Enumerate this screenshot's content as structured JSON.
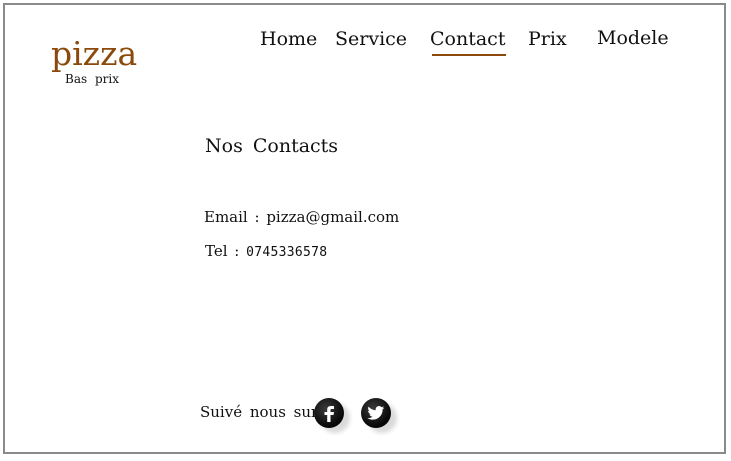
{
  "brand": {
    "name": "pizza",
    "tagline": "Bas prix",
    "color": "#8b4a0b"
  },
  "nav": {
    "items": [
      {
        "label": "Home"
      },
      {
        "label": "Service"
      },
      {
        "label": "Contact",
        "active": true
      },
      {
        "label": "Prix"
      },
      {
        "label": "Modele"
      }
    ]
  },
  "main": {
    "heading": "Nos Contacts",
    "email_label": "Email :",
    "email_value": "pizza@gmail.com",
    "tel_label": "Tel :",
    "tel_value": "0745336578"
  },
  "footer": {
    "follow_text": "Suivé nous sur",
    "social": [
      {
        "icon": "facebook-icon",
        "glyph": "f"
      },
      {
        "icon": "twitter-icon",
        "glyph": "t"
      }
    ]
  }
}
